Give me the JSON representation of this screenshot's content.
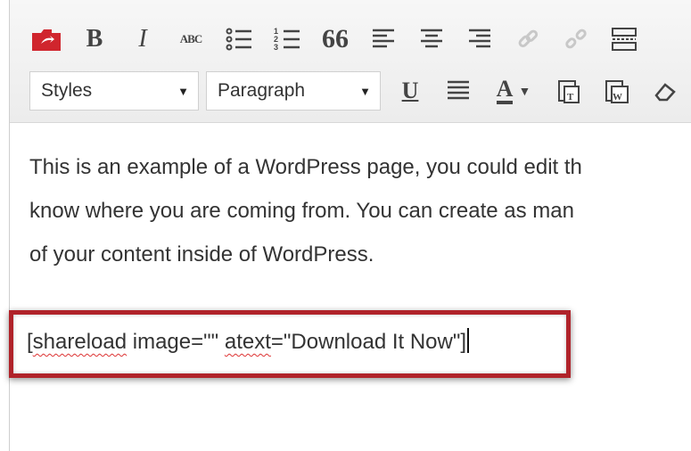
{
  "toolbar": {
    "row1": [
      {
        "name": "wp-menu-icon",
        "glyph": "",
        "label": ""
      },
      {
        "name": "bold-button",
        "label": "B"
      },
      {
        "name": "italic-button",
        "label": "I"
      },
      {
        "name": "strikethrough-button",
        "label": "ABC"
      },
      {
        "name": "bulleted-list-button",
        "glyph": "☰"
      },
      {
        "name": "numbered-list-button",
        "glyph": "☷"
      },
      {
        "name": "blockquote-button",
        "label": "66"
      },
      {
        "name": "align-left-button",
        "glyph": "≡"
      },
      {
        "name": "align-center-button",
        "glyph": "☰"
      },
      {
        "name": "align-right-button",
        "glyph": "≡"
      },
      {
        "name": "link-button",
        "glyph": "🔗"
      },
      {
        "name": "unlink-button",
        "glyph": "⛓"
      },
      {
        "name": "more-tag-button",
        "glyph": "▤"
      }
    ],
    "styles_select": "Styles",
    "format_select": "Paragraph",
    "underline_label": "U",
    "textcolor_label": "A"
  },
  "content": {
    "paragraph_lines": [
      "This is an example of a WordPress page, you could edit th",
      "know where you are coming from. You can create as man",
      "of your content inside of WordPress."
    ],
    "shortcode": {
      "open": "[",
      "tag": "shareload",
      "image_attr": " image=\"\" ",
      "atext_name": "atext",
      "atext_value": "=\"Download It Now\"]"
    }
  },
  "colors": {
    "highlight_border": "#b0232a",
    "wp_icon_red": "#d0252d"
  }
}
